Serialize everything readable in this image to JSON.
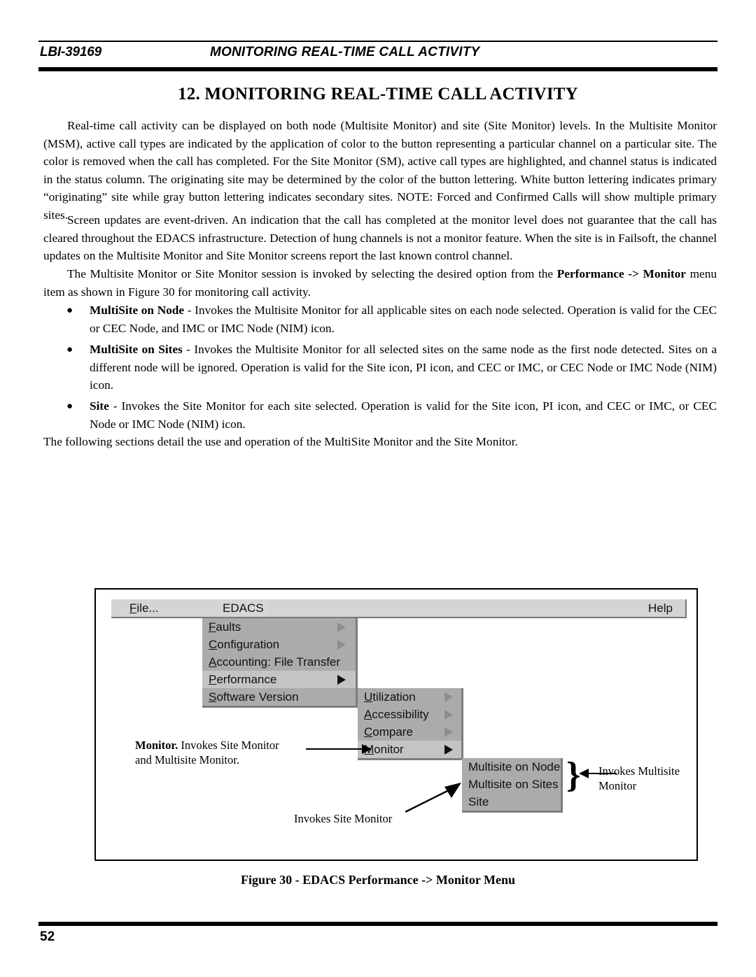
{
  "header": {
    "doc_id": "LBI-39169",
    "running_title": "MONITORING REAL-TIME CALL ACTIVITY"
  },
  "chapter": {
    "title": "12.  MONITORING REAL-TIME CALL ACTIVITY"
  },
  "paragraphs": {
    "p1": "Real-time call activity can be displayed on both node (Multisite Monitor) and site (Site Monitor) levels.  In the Multisite Monitor (MSM), active call types are indicated by the application of color to the button representing a particular channel on a particular site.  The color is removed when the call has completed.  For the Site Monitor (SM), active call types are highlighted, and channel status is indicated in the status column.  The originating site may be determined by the color of the button lettering.  White button lettering indicates primary “originating” site while gray button lettering indicates secondary sites. NOTE:  Forced and Confirmed Calls will show multiple primary sites.",
    "p2": "Screen updates are event-driven.  An indication that the call has completed at the monitor level does not guarantee that the call has cleared throughout the EDACS infrastructure.  Detection of hung channels is not a monitor feature.  When the site is in Failsoft, the channel updates on the Multisite Monitor and Site Monitor screens report the last known control channel.",
    "p3_part1": "The Multisite Monitor or Site Monitor session is invoked by selecting the desired option from the ",
    "p3_bold1": "Performance -> Monitor",
    "p3_part2": " menu item as shown in Figure 30 for monitoring call activity.",
    "closing": "The following sections detail the use and operation of the MultiSite Monitor and the Site Monitor."
  },
  "bullets": [
    {
      "marker": "●",
      "term": "MultiSite on Node",
      "text": " - Invokes the Multisite Monitor for all applicable sites on each node selected.  Operation is valid for the CEC or CEC Node, and IMC or IMC Node (NIM) icon."
    },
    {
      "marker": "●",
      "term": "MultiSite on Sites",
      "text": " - Invokes the Multisite Monitor for all selected sites on the same node as the first node detected.  Sites on a different node will be ignored.  Operation is valid for the Site icon, PI icon, and CEC or IMC, or CEC Node or IMC Node (NIM) icon."
    },
    {
      "marker": "●",
      "term": "Site",
      "text": " - Invokes the Site Monitor for each site selected.  Operation is valid for the Site icon, PI icon, and CEC or IMC, or CEC Node or IMC Node (NIM) icon."
    }
  ],
  "figure": {
    "menubar": {
      "file": {
        "mnemonic": "F",
        "rest": "ile..."
      },
      "edacs": {
        "label": "EDACS"
      },
      "help": {
        "label": "Help"
      }
    },
    "edacs_menu": [
      {
        "mnemonic": "F",
        "rest": "aults",
        "arrow": "outline",
        "highlighted": false
      },
      {
        "mnemonic": "C",
        "rest": "onfiguration",
        "arrow": "outline",
        "highlighted": false
      },
      {
        "mnemonic": "A",
        "rest": "ccounting: File Transfer",
        "arrow": "none",
        "highlighted": false
      },
      {
        "mnemonic": "P",
        "rest": "erformance",
        "arrow": "solid",
        "highlighted": true
      },
      {
        "mnemonic": "S",
        "rest": "oftware Version",
        "arrow": "none",
        "highlighted": false
      }
    ],
    "performance_menu": [
      {
        "mnemonic": "U",
        "rest": "tilization",
        "arrow": "outline",
        "highlighted": false
      },
      {
        "mnemonic": "A",
        "rest": "ccessibility",
        "arrow": "outline",
        "highlighted": false
      },
      {
        "mnemonic": "C",
        "rest": "ompare",
        "arrow": "outline",
        "highlighted": false
      },
      {
        "mnemonic": "M",
        "rest": "onitor",
        "arrow": "solid",
        "highlighted": true
      }
    ],
    "monitor_menu": [
      {
        "mnemonic": "",
        "rest": "Multisite on Node",
        "arrow": "none",
        "highlighted": false
      },
      {
        "mnemonic": "",
        "rest": "Multisite on Sites",
        "arrow": "none",
        "highlighted": false
      },
      {
        "mnemonic": "",
        "rest": "Site",
        "arrow": "none",
        "highlighted": false
      }
    ],
    "annotations": {
      "monitor_bold": "Monitor.",
      "monitor_rest": "  Invokes Site Monitor",
      "monitor_line2": "and Multisite Monitor.",
      "multisite_line1": "Invokes Multisite",
      "multisite_line2": "Monitor",
      "site": "Invokes Site Monitor",
      "brace_glyph": "}"
    }
  },
  "caption": "Figure 30 - EDACS Performance -> Monitor Menu",
  "footer": {
    "page_number": "52"
  },
  "colors": {
    "menubar_bg": "#d4d4d4",
    "menu_panel_bg": "#ababab",
    "menu_highlight_bg": "#c4c4c4",
    "shadow": "#7d7d7d",
    "text": "#111111"
  }
}
